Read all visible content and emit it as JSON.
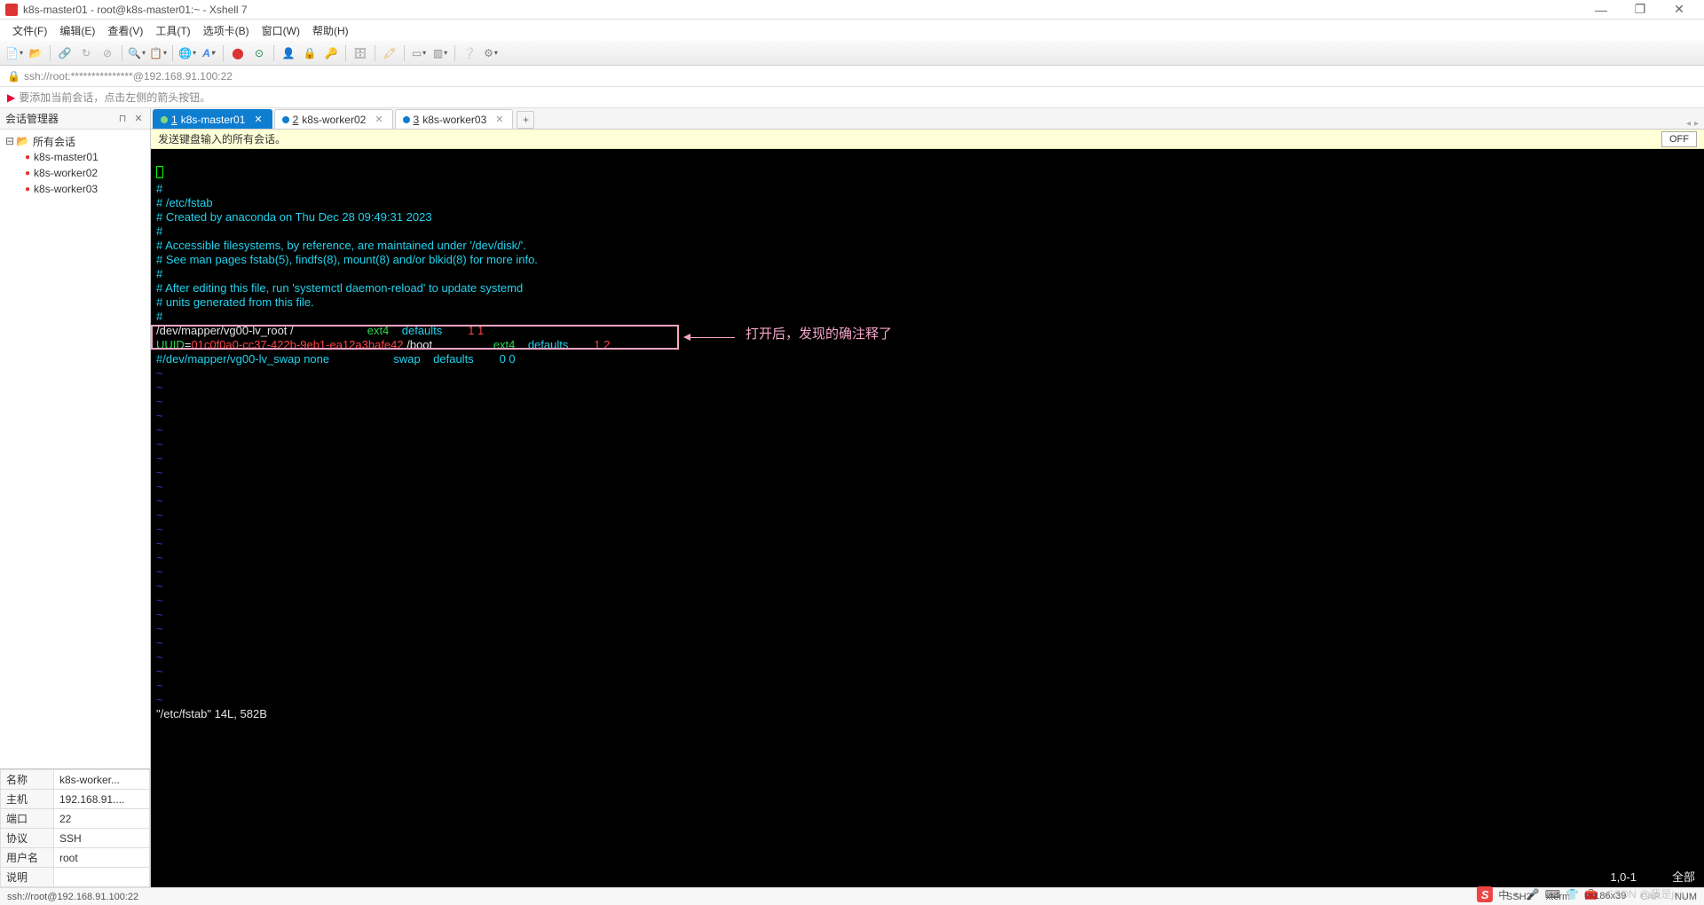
{
  "window": {
    "title": "k8s-master01 - root@k8s-master01:~ - Xshell 7",
    "minimize": "—",
    "maximize": "❐",
    "close": "✕"
  },
  "menu": {
    "file": "文件(F)",
    "edit": "编辑(E)",
    "view": "查看(V)",
    "tools": "工具(T)",
    "tabs": "选项卡(B)",
    "window": "窗口(W)",
    "help": "帮助(H)"
  },
  "address": "ssh://root:***************@192.168.91.100:22",
  "info": "要添加当前会话，点击左侧的箭头按钮。",
  "sidebar": {
    "title": "会话管理器",
    "root": "所有会话",
    "items": [
      "k8s-master01",
      "k8s-worker02",
      "k8s-worker03"
    ]
  },
  "props": {
    "name_label": "名称",
    "name_val": "k8s-worker...",
    "host_label": "主机",
    "host_val": "192.168.91....",
    "port_label": "端口",
    "port_val": "22",
    "proto_label": "协议",
    "proto_val": "SSH",
    "user_label": "用户名",
    "user_val": "root",
    "desc_label": "说明",
    "desc_val": ""
  },
  "tabs": {
    "t1_num": "1",
    "t1_label": " k8s-master01",
    "t2_num": "2",
    "t2_label": " k8s-worker02",
    "t3_num": "3",
    "t3_label": " k8s-worker03",
    "add": "+"
  },
  "notice": {
    "text": "发送键盘输入的所有会话。",
    "off": "OFF"
  },
  "terminal": {
    "l1": "#",
    "l2": "# /etc/fstab",
    "l3": "# Created by anaconda on Thu Dec 28 09:49:31 2023",
    "l4": "#",
    "l5": "# Accessible filesystems, by reference, are maintained under '/dev/disk/'.",
    "l6": "# See man pages fstab(5), findfs(8), mount(8) and/or blkid(8) for more info.",
    "l7": "#",
    "l8": "# After editing this file, run 'systemctl daemon-reload' to update systemd",
    "l9": "# units generated from this file.",
    "l10": "#",
    "root_dev": "/dev/mapper/vg00-lv_root /                       ",
    "root_fs": "ext4    ",
    "root_opts": "defaults        ",
    "root_dump": "1 1",
    "uuid_key": "UUID",
    "uuid_eq": "=",
    "uuid_val": "01c0f0a0-cc37-422b-9eb1-ea12a3bafe42",
    "boot_mount": " /boot                   ",
    "boot_fs": "ext4    ",
    "boot_opts": "defaults        ",
    "boot_dump": "1 2",
    "swap_line": "#/dev/mapper/vg00-lv_swap none                    swap    defaults        0 0",
    "tilde": "~",
    "status_file": "\"/etc/fstab\" 14L, 582B",
    "status_pos": "1,0-1",
    "status_all": "全部",
    "annotation": "打开后，发现的确注释了"
  },
  "statusbar": {
    "left": "ssh://root@192.168.91.100:22",
    "ssh": "SSH2",
    "term": "xterm",
    "size": "186x39",
    "caps": "CAP",
    "num": "NUM"
  },
  "watermark": "CSDN @我是juju"
}
